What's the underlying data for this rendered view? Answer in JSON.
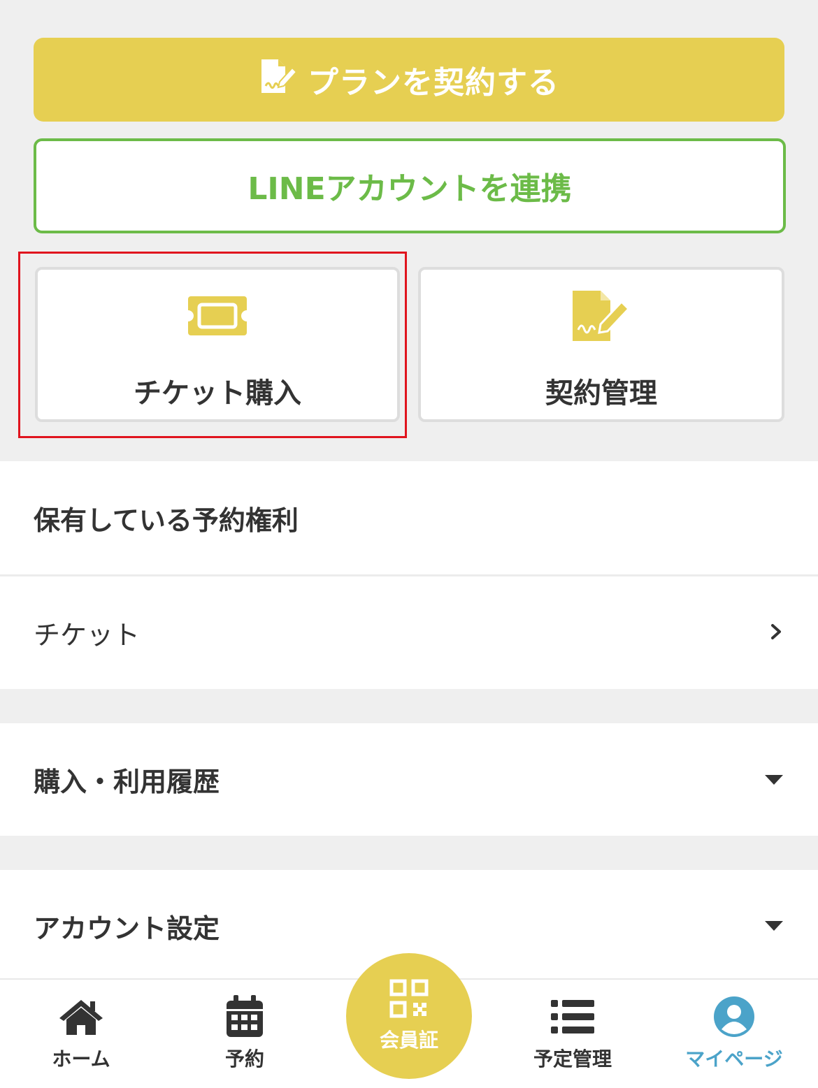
{
  "actions": {
    "plan_label": "プランを契約する",
    "line_label": "LINEアカウントを連携"
  },
  "tiles": [
    {
      "label": "チケット購入",
      "icon": "ticket-icon"
    },
    {
      "label": "契約管理",
      "icon": "contract-icon"
    }
  ],
  "sections": {
    "rights_title": "保有している予約権利",
    "ticket_label": "チケット",
    "history_title": "購入・利用履歴",
    "account_title": "アカウント設定"
  },
  "nav": {
    "home": "ホーム",
    "reserve": "予約",
    "member": "会員証",
    "schedule": "予定管理",
    "mypage": "マイページ"
  },
  "colors": {
    "accent_yellow": "#e6cf52",
    "line_green": "#6cbb48",
    "active_blue": "#4ba3c9",
    "highlight_red": "#e0141e"
  }
}
